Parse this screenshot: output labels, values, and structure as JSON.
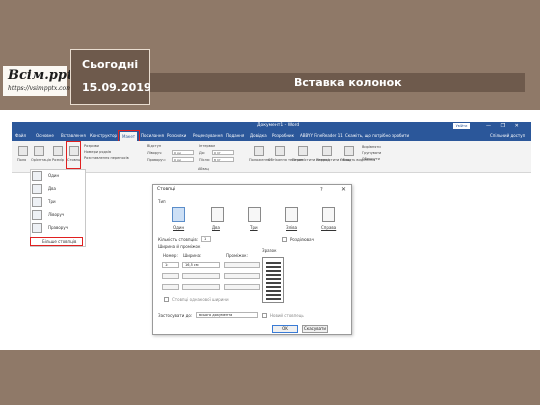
{
  "logo": {
    "title": "Всім.pptx",
    "url": "https://vsimpptx.com"
  },
  "date_card": {
    "header": "Сьогодні",
    "date": "15.09.2019"
  },
  "slide_title": "Вставка колонок",
  "word": {
    "doc_title": "Документ1 - Word",
    "login": "Увійти",
    "window_controls": "— ❐ ✕",
    "menu": [
      "Файл",
      "Основне",
      "Вставлення",
      "Конструктор",
      "Макет",
      "Посилання",
      "Розсилки",
      "Рецензування",
      "Подання",
      "Довідка",
      "Розробник",
      "ABBYY FineReader 11",
      "Скажіть, що потрібно зробити",
      "Спільний доступ"
    ],
    "menu_active_index": 4,
    "ribbon": {
      "fields": "Поля",
      "orientation": "Орієнтація",
      "size": "Розмір",
      "columns": "Стовпці",
      "breaks": "Розриви",
      "line_numbers": "Номери рядків",
      "hyphenation": "Розставлення переносів",
      "indent": "Відступ",
      "spacing": "Інтервал",
      "left": "Ліворуч:",
      "right": "Праворуч:",
      "before": "До:",
      "after": "Після:",
      "indent_left_val": "0 см",
      "indent_right_val": "0 см",
      "before_val": "0 пт",
      "after_val": "8 пт",
      "arrange": [
        "Положення",
        "Обтікання текстом",
        "Перемістити вперед",
        "Перемістити назад",
        "Область виділення"
      ],
      "align": "Вирівняти",
      "group": "Групувати",
      "rotate": "Обернути",
      "group_label": "Абзац"
    }
  },
  "dropdown": {
    "items": [
      "Один",
      "Два",
      "Три",
      "Ліворуч",
      "Праворуч"
    ],
    "more": "Більше стовпців"
  },
  "dialog": {
    "title": "Стовпці",
    "help": "?",
    "close": "✕",
    "type_label": "Тип",
    "presets": [
      "Один",
      "Два",
      "Три",
      "Зліва",
      "Справа"
    ],
    "num_columns_label": "Кількість стовпців:",
    "num_columns_value": "1",
    "separator_label": "Розділювач",
    "width_spacing_label": "Ширина й проміжок",
    "preview_label": "Зразок",
    "col_header_number": "Номер:",
    "col_header_width": "Ширина:",
    "col_header_spacing": "Проміжок:",
    "row_number": "1:",
    "row_width": "16,5 см",
    "equal_width": "Стовпці однакової ширини",
    "apply_to_label": "Застосувати до:",
    "apply_to_value": "всього документа",
    "new_column": "Новий стовпець",
    "ok": "OK",
    "cancel": "Скасувати"
  }
}
